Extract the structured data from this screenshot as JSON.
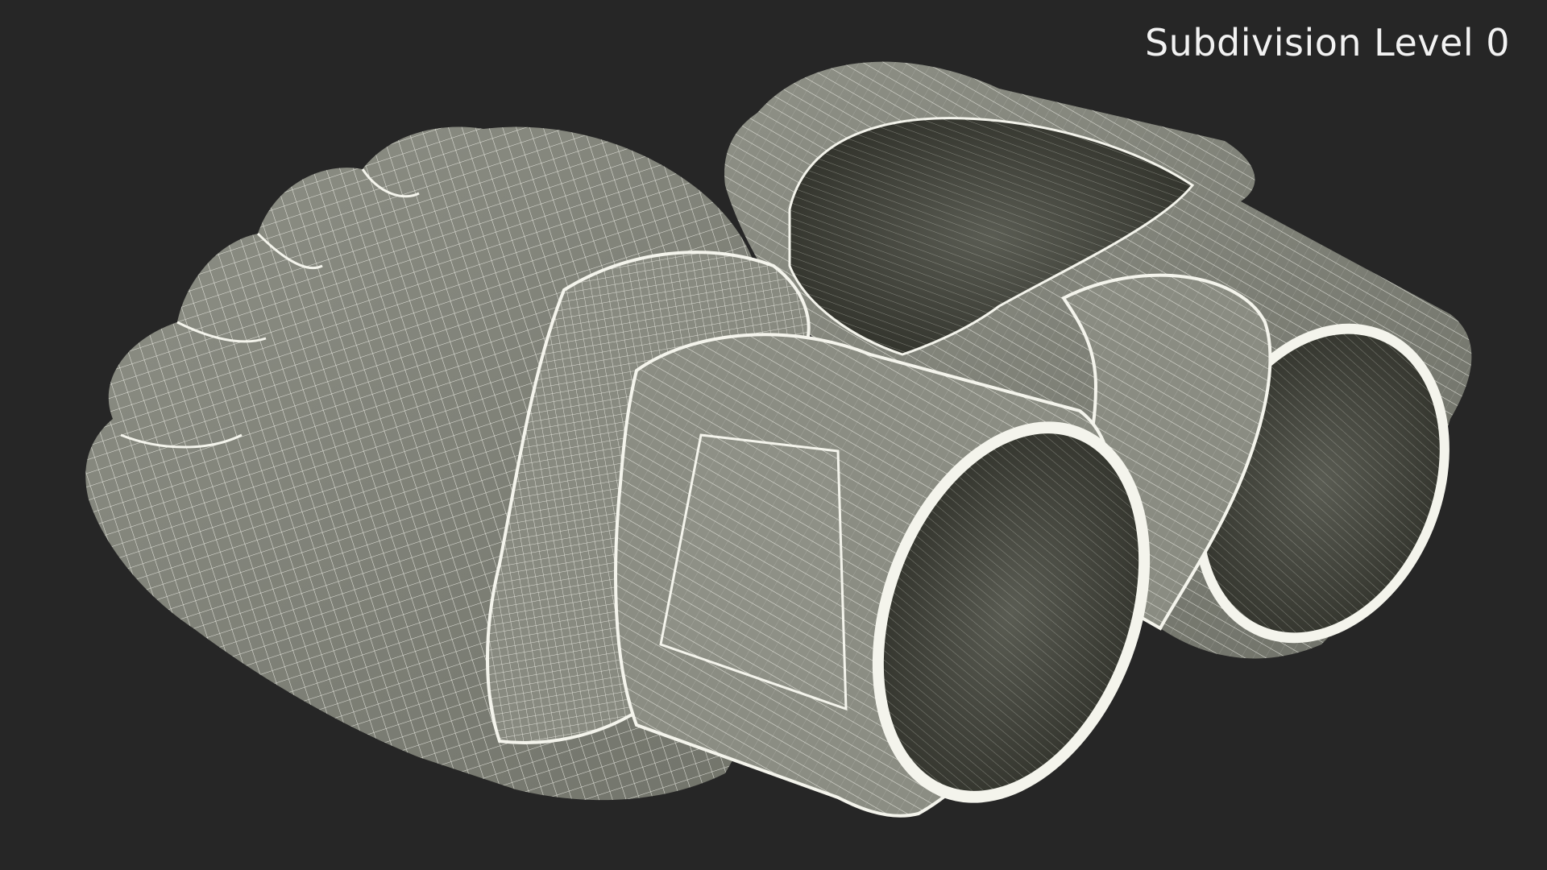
{
  "viewport": {
    "label": "Subdivision Level 0",
    "background": "#262626",
    "mesh_fill": "#85877d",
    "mesh_shadow": "#3e4038",
    "wire_color": "#f4f4ec"
  }
}
